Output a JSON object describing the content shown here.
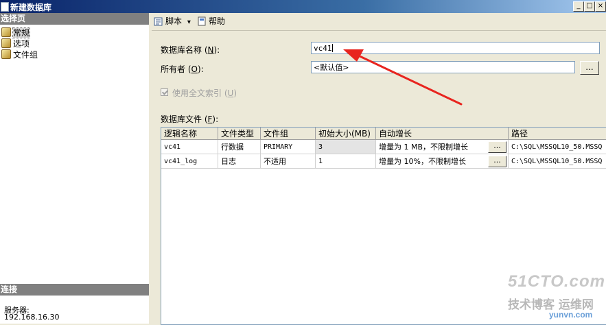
{
  "window": {
    "title": "新建数据库",
    "min_label": "_",
    "max_label": "□",
    "close_label": "×"
  },
  "left_panel": {
    "select_page_header": "选择页",
    "pages": [
      {
        "label": "常规"
      },
      {
        "label": "选项"
      },
      {
        "label": "文件组"
      }
    ],
    "connection_header": "连接",
    "server_label": "服务器:",
    "server_value": "192.168.16.30"
  },
  "toolbar": {
    "script_label": "脚本",
    "script_dropdown": "▾",
    "help_label": "帮助"
  },
  "form": {
    "db_name_label": "数据库名称",
    "db_name_hotkey": "N",
    "db_name_value": "vc41",
    "owner_label": "所有者",
    "owner_hotkey": "O",
    "owner_value": "<默认值>",
    "owner_browse": "...",
    "fulltext_label": "使用全文索引",
    "fulltext_hotkey": "U",
    "fulltext_checked": true,
    "files_label": "数据库文件",
    "files_hotkey": "F"
  },
  "files_table": {
    "columns": [
      "逻辑名称",
      "文件类型",
      "文件组",
      "初始大小(MB)",
      "自动增长",
      "路径"
    ],
    "rows": [
      {
        "name": "vc41",
        "type": "行数据",
        "filegroup": "PRIMARY",
        "size": "3",
        "growth": "增量为 1 MB，不限制增长",
        "path": "C:\\SQL\\MSSQL10_50.MSSQ"
      },
      {
        "name": "vc41_log",
        "type": "日志",
        "filegroup": "不适用",
        "size": "1",
        "growth": "增量为 10%，不限制增长",
        "path": "C:\\SQL\\MSSQL10_50.MSSQ"
      }
    ],
    "growth_button": "..."
  },
  "watermark": {
    "line1": "51CTO.com",
    "line2": "技术博客 运维网",
    "line3": "yunvn.com"
  },
  "colors": {
    "annotation_arrow": "#e8251f",
    "title_bar": "#0a246a"
  }
}
